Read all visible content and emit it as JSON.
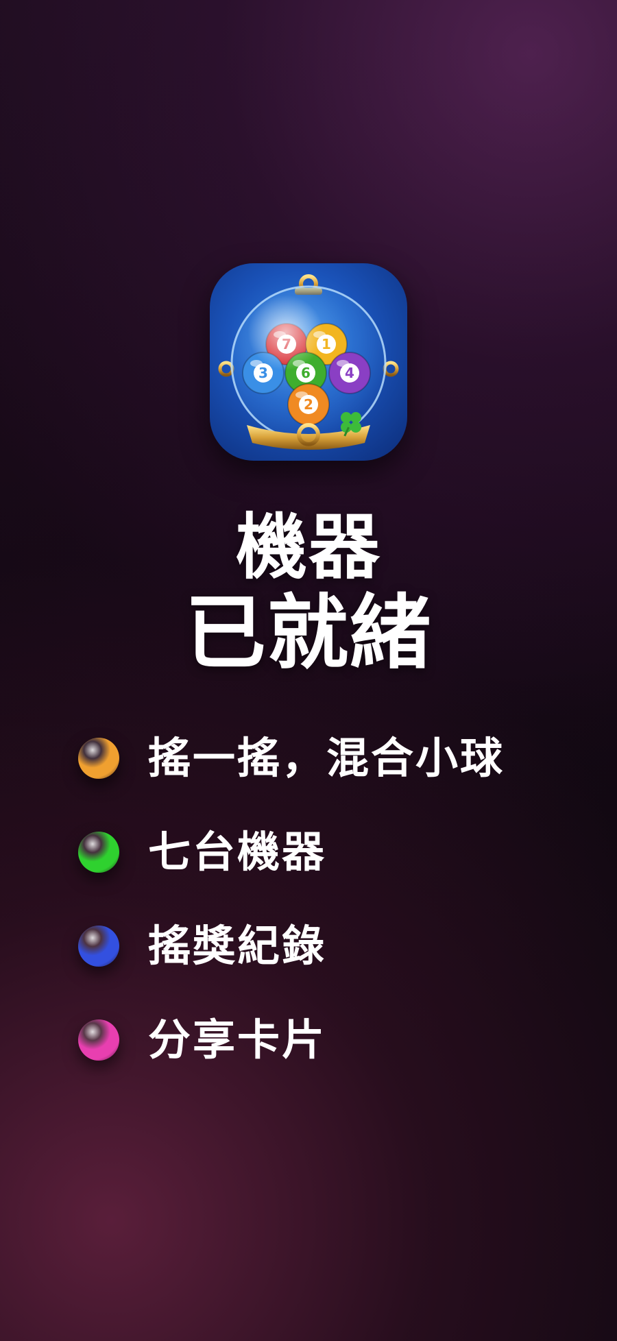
{
  "app_icon": {
    "icon": "lottery-ball-globe-icon",
    "balls": [
      {
        "number": "7",
        "color": "#d8282e"
      },
      {
        "number": "1",
        "color": "#f2b520"
      },
      {
        "number": "3",
        "color": "#3a8fe6"
      },
      {
        "number": "6",
        "color": "#3fae2e"
      },
      {
        "number": "4",
        "color": "#8a3fc4"
      },
      {
        "number": "2",
        "color": "#f08a22"
      }
    ]
  },
  "title": {
    "line1": "機器",
    "line2": "已就緒"
  },
  "features": [
    {
      "label": "搖一搖，混合小球",
      "ball_color": "#f0a030",
      "icon": "orange-ball-icon"
    },
    {
      "label": "七台機器",
      "ball_color": "#2fd12f",
      "icon": "green-ball-icon"
    },
    {
      "label": "搖獎紀錄",
      "ball_color": "#3350e0",
      "icon": "blue-ball-icon"
    },
    {
      "label": "分享卡片",
      "ball_color": "#e83fb0",
      "icon": "magenta-ball-icon"
    }
  ]
}
